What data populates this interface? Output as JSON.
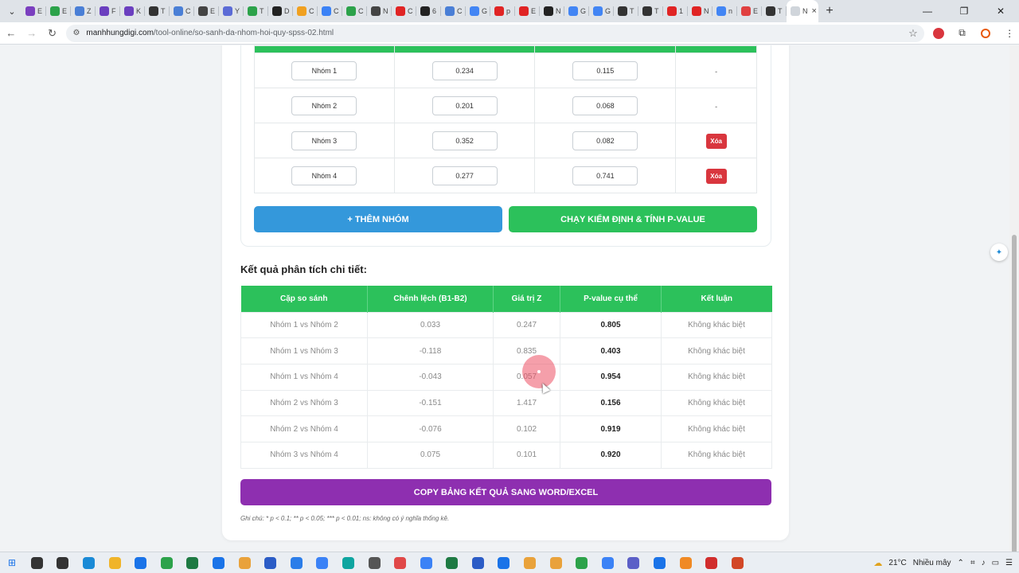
{
  "browser": {
    "tabs": [
      {
        "favicon_color": "#7b3fbf",
        "label": "E"
      },
      {
        "favicon_color": "#2ca24a",
        "label": "E"
      },
      {
        "favicon_color": "#4a7fd6",
        "label": "Z"
      },
      {
        "favicon_color": "#6b3fbf",
        "label": "F"
      },
      {
        "favicon_color": "#6b3fbf",
        "label": "K"
      },
      {
        "favicon_color": "#333333",
        "label": "T"
      },
      {
        "favicon_color": "#4a7fd6",
        "label": "C"
      },
      {
        "favicon_color": "#444444",
        "label": "E"
      },
      {
        "favicon_color": "#5b6bd6",
        "label": "Y"
      },
      {
        "favicon_color": "#2ca24a",
        "label": "T"
      },
      {
        "favicon_color": "#222222",
        "label": "D"
      },
      {
        "favicon_color": "#f0a020",
        "label": "C"
      },
      {
        "favicon_color": "#3b82f6",
        "label": "C"
      },
      {
        "favicon_color": "#2ca24a",
        "label": "C"
      },
      {
        "favicon_color": "#444444",
        "label": "N"
      },
      {
        "favicon_color": "#e02424",
        "label": "C"
      },
      {
        "favicon_color": "#222222",
        "label": "6"
      },
      {
        "favicon_color": "#4a7fd6",
        "label": "C"
      },
      {
        "favicon_color": "#4285f4",
        "label": "G"
      },
      {
        "favicon_color": "#e02424",
        "label": "p"
      },
      {
        "favicon_color": "#e02424",
        "label": "E"
      },
      {
        "favicon_color": "#222222",
        "label": "N"
      },
      {
        "favicon_color": "#4285f4",
        "label": "G"
      },
      {
        "favicon_color": "#4285f4",
        "label": "G"
      },
      {
        "favicon_color": "#333333",
        "label": "T"
      },
      {
        "favicon_color": "#333333",
        "label": "T"
      },
      {
        "favicon_color": "#e02424",
        "label": "1"
      },
      {
        "favicon_color": "#e02424",
        "label": "N"
      },
      {
        "favicon_color": "#4285f4",
        "label": "n"
      },
      {
        "favicon_color": "#e04040",
        "label": "E"
      },
      {
        "favicon_color": "#333333",
        "label": "T"
      }
    ],
    "active_tab": {
      "label": "N"
    },
    "url_domain": "manhhungdigi.com",
    "url_path": "/tool-online/so-sanh-da-nhom-hoi-quy-spss-02.html"
  },
  "groups": {
    "rows": [
      {
        "name": "Nhóm 1",
        "b": "0.234",
        "se": "0.115",
        "action": "-"
      },
      {
        "name": "Nhóm 2",
        "b": "0.201",
        "se": "0.068",
        "action": "-"
      },
      {
        "name": "Nhóm 3",
        "b": "0.352",
        "se": "0.082",
        "action": "Xóa"
      },
      {
        "name": "Nhóm 4",
        "b": "0.277",
        "se": "0.741",
        "action": "Xóa"
      }
    ],
    "add_button": "+ THÊM NHÓM",
    "run_button": "CHẠY KIỂM ĐỊNH & TÍNH P-VALUE"
  },
  "results": {
    "heading": "Kết quả phân tích chi tiết:",
    "columns": [
      "Cặp so sánh",
      "Chênh lệch (B1-B2)",
      "Giá trị Z",
      "P-value cụ thể",
      "Kết luận"
    ],
    "rows": [
      {
        "pair": "Nhóm 1 vs Nhóm 2",
        "diff": "0.033",
        "z": "0.247",
        "p": "0.805",
        "conclusion": "Không khác biệt"
      },
      {
        "pair": "Nhóm 1 vs Nhóm 3",
        "diff": "-0.118",
        "z": "0.835",
        "p": "0.403",
        "conclusion": "Không khác biệt"
      },
      {
        "pair": "Nhóm 1 vs Nhóm 4",
        "diff": "-0.043",
        "z": "0.057",
        "p": "0.954",
        "conclusion": "Không khác biệt"
      },
      {
        "pair": "Nhóm 2 vs Nhóm 3",
        "diff": "-0.151",
        "z": "1.417",
        "p": "0.156",
        "conclusion": "Không khác biệt"
      },
      {
        "pair": "Nhóm 2 vs Nhóm 4",
        "diff": "-0.076",
        "z": "0.102",
        "p": "0.919",
        "conclusion": "Không khác biệt"
      },
      {
        "pair": "Nhóm 3 vs Nhóm 4",
        "diff": "0.075",
        "z": "0.101",
        "p": "0.920",
        "conclusion": "Không khác biệt"
      }
    ],
    "copy_button": "COPY BẢNG KẾT QUẢ SANG WORD/EXCEL",
    "footnote": "Ghi chú: * p < 0.1; ** p < 0.05; *** p < 0.01; ns: không có ý nghĩa thống kê."
  },
  "colors": {
    "green": "#2cc15b",
    "blue": "#3498db",
    "purple": "#8e2fb0",
    "delete_red": "#d9363e"
  },
  "taskbar": {
    "icons": [
      {
        "name": "search-icon",
        "color": "#333333"
      },
      {
        "name": "task-view-icon",
        "color": "#333333"
      },
      {
        "name": "edge-icon",
        "color": "#1a8ad6"
      },
      {
        "name": "file-explorer-icon",
        "color": "#f0b429"
      },
      {
        "name": "mail-icon",
        "color": "#1a73e8"
      },
      {
        "name": "app-green-icon",
        "color": "#2ca24a"
      },
      {
        "name": "excel-icon",
        "color": "#1e7a43"
      },
      {
        "name": "app-blue-icon",
        "color": "#1a73e8"
      },
      {
        "name": "chrome-icon",
        "color": "#e9a23b"
      },
      {
        "name": "word-icon",
        "color": "#2b5cc6"
      },
      {
        "name": "app-snow-icon",
        "color": "#2b7de9"
      },
      {
        "name": "app-globe-icon",
        "color": "#3b82f6"
      },
      {
        "name": "app-dots-icon",
        "color": "#0ea5a0"
      },
      {
        "name": "app-feather-icon",
        "color": "#555555"
      },
      {
        "name": "app-red-circle-icon",
        "color": "#e04848"
      },
      {
        "name": "app-blue-circle-icon",
        "color": "#3b82f6"
      },
      {
        "name": "excel-2-icon",
        "color": "#1e7a43"
      },
      {
        "name": "word-2-icon",
        "color": "#2b5cc6"
      },
      {
        "name": "app-dts-icon",
        "color": "#1a73e8"
      },
      {
        "name": "chrome-2-icon",
        "color": "#e9a23b"
      },
      {
        "name": "chrome-3-icon",
        "color": "#e9a23b"
      },
      {
        "name": "app-camtasia-icon",
        "color": "#2ca24a"
      },
      {
        "name": "app-globe-2-icon",
        "color": "#3b82f6"
      },
      {
        "name": "teams-icon",
        "color": "#5b5fc7"
      },
      {
        "name": "zalo-icon",
        "color": "#1a73e8"
      },
      {
        "name": "app-orange-icon",
        "color": "#f08a24"
      },
      {
        "name": "app-red-icon",
        "color": "#d12d2d"
      },
      {
        "name": "powerpoint-icon",
        "color": "#d24726"
      }
    ],
    "temperature": "21°C",
    "weather": "Nhiều mây"
  }
}
